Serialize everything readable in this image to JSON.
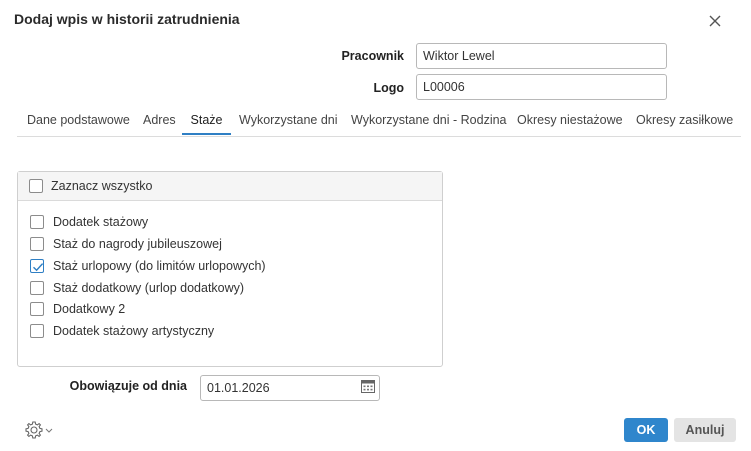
{
  "dialog": {
    "title": "Dodaj wpis w historii zatrudnienia"
  },
  "fields": {
    "pracownik": {
      "label": "Pracownik",
      "value": "Wiktor Lewel"
    },
    "logo": {
      "label": "Logo",
      "value": "L00006"
    }
  },
  "tabs": [
    {
      "label": "Dane podstawowe",
      "active": false
    },
    {
      "label": "Adres",
      "active": false
    },
    {
      "label": "Staże",
      "active": true
    },
    {
      "label": "Wykorzystane dni",
      "active": false
    },
    {
      "label": "Wykorzystane dni - Rodzina",
      "active": false
    },
    {
      "label": "Okresy niestażowe",
      "active": false
    },
    {
      "label": "Okresy zasiłkowe",
      "active": false
    }
  ],
  "panel": {
    "select_all": {
      "label": "Zaznacz wszystko",
      "checked": false
    },
    "items": [
      {
        "label": "Dodatek stażowy",
        "checked": false
      },
      {
        "label": "Staż do nagrody jubileuszowej",
        "checked": false
      },
      {
        "label": "Staż urlopowy (do limitów urlopowych)",
        "checked": true
      },
      {
        "label": "Staż dodatkowy (urlop dodatkowy)",
        "checked": false
      },
      {
        "label": "Dodatkowy 2",
        "checked": false
      },
      {
        "label": "Dodatek stażowy artystyczny",
        "checked": false
      }
    ]
  },
  "valid_from": {
    "label": "Obowiązuje od dnia",
    "value": "01.01.2026"
  },
  "footer": {
    "ok_label": "OK",
    "cancel_label": "Anuluj"
  },
  "colors": {
    "accent": "#2f86cc",
    "tab_underline": "#2f7fc4",
    "panel_header_bg": "#f5f5f5"
  }
}
